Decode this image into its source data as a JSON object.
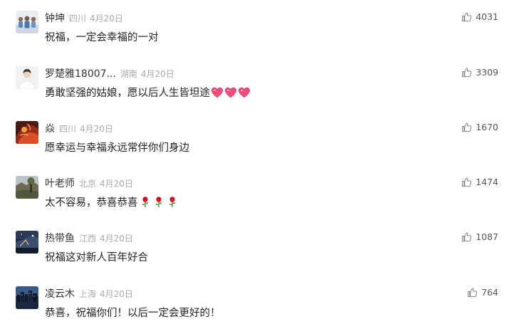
{
  "comments": [
    {
      "username": "钟坤",
      "location": "四川",
      "date": "4月20日",
      "text": "祝福，一定会幸福的一对",
      "emojis": [],
      "likes": "4031",
      "avatar_icon": "family-photo-avatar"
    },
    {
      "username": "罗楚雅18007...",
      "location": "湖南",
      "date": "4月20日",
      "text": "勇敢坚强的姑娘，愿以后人生皆坦途",
      "emojis": [
        "heart-emoji",
        "heart-emoji",
        "heart-emoji"
      ],
      "likes": "3309",
      "avatar_icon": "portrait-avatar"
    },
    {
      "username": "焱",
      "location": "四川",
      "date": "4月20日",
      "text": "愿幸运与幸福永远常伴你们身边",
      "emojis": [],
      "likes": "1670",
      "avatar_icon": "red-art-avatar"
    },
    {
      "username": "叶老师",
      "location": "北京",
      "date": "4月20日",
      "text": "太不容易，恭喜恭喜",
      "emojis": [
        "rose-emoji",
        "rose-emoji",
        "rose-emoji"
      ],
      "likes": "1474",
      "avatar_icon": "landscape-avatar"
    },
    {
      "username": "热带鱼",
      "location": "江西",
      "date": "4月20日",
      "text": "祝福这对新人百年好合",
      "emojis": [],
      "likes": "1087",
      "avatar_icon": "night-sky-avatar"
    },
    {
      "username": "凌云木",
      "location": "上海",
      "date": "4月20日",
      "text": "恭喜，祝福你们！以后一定会更好的！",
      "emojis": [],
      "likes": "764",
      "avatar_icon": "city-night-avatar"
    }
  ],
  "colors": {
    "username": "#333333",
    "meta": "#aaaaaa",
    "text": "#222222",
    "like_icon": "#888888"
  }
}
